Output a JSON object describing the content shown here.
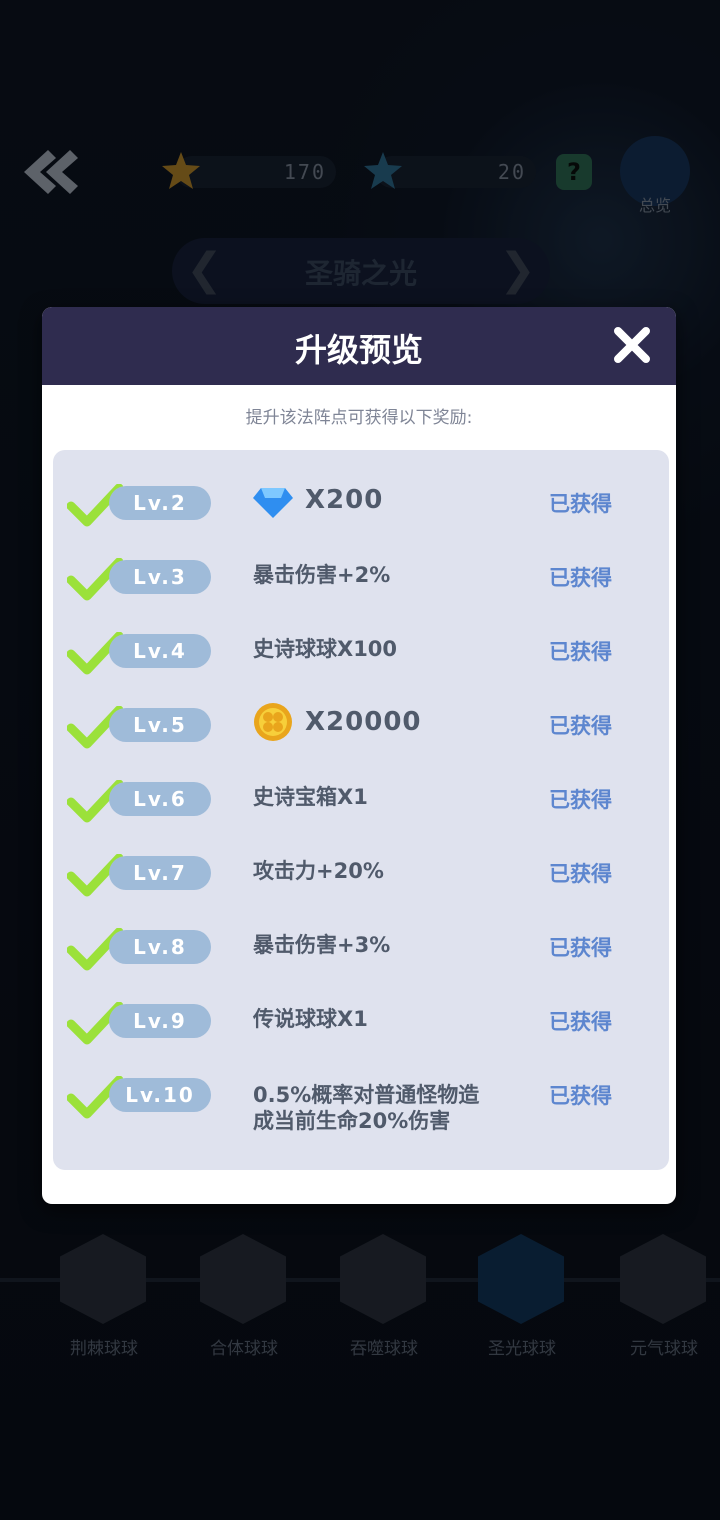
{
  "topbar": {
    "star_gold_value": "170",
    "star_blue_value": "20",
    "help_label": "?",
    "overview_label": "总览"
  },
  "selector": {
    "title": "圣骑之光",
    "prev": "❮",
    "next": "❯"
  },
  "skills": [
    {
      "label": "荆棘球球"
    },
    {
      "label": "合体球球"
    },
    {
      "label": "吞噬球球"
    },
    {
      "label": "圣光球球"
    },
    {
      "label": "元气球球"
    }
  ],
  "modal": {
    "title": "升级预览",
    "subtitle": "提升该法阵点可获得以下奖励:",
    "rows": [
      {
        "level": "Lv.2",
        "reward": "X200",
        "icon": "diamond-icon",
        "status": "已获得"
      },
      {
        "level": "Lv.3",
        "reward": "暴击伤害+2%",
        "status": "已获得"
      },
      {
        "level": "Lv.4",
        "reward": "史诗球球X100",
        "status": "已获得"
      },
      {
        "level": "Lv.5",
        "reward": "X20000",
        "icon": "coin-icon",
        "status": "已获得"
      },
      {
        "level": "Lv.6",
        "reward": "史诗宝箱X1",
        "status": "已获得"
      },
      {
        "level": "Lv.7",
        "reward": "攻击力+20%",
        "status": "已获得"
      },
      {
        "level": "Lv.8",
        "reward": "暴击伤害+3%",
        "status": "已获得"
      },
      {
        "level": "Lv.9",
        "reward": "传说球球X1",
        "status": "已获得"
      },
      {
        "level": "Lv.10",
        "reward_line1": "0.5%概率对普通怪物造",
        "reward_line2": "成当前生命20%伤害",
        "status": "已获得"
      }
    ]
  },
  "colors": {
    "accent": "#5d86cf",
    "header": "#2f2c4f",
    "check": "#9be13a"
  }
}
